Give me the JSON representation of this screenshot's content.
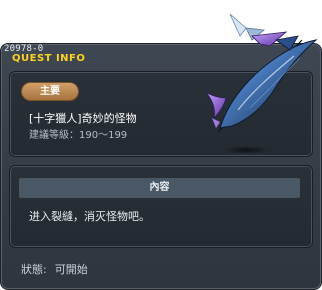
{
  "window": {
    "quest_id": "20978-0",
    "title": "QUEST INFO"
  },
  "main_panel": {
    "badge": "主要",
    "quest_name": "[十字獵人]奇妙的怪物",
    "level_label": "建議等級：",
    "level_range": "190～199"
  },
  "content_panel": {
    "header": "內容",
    "text": "进入裂縫，消灭怪物吧。"
  },
  "status": {
    "label": "狀態:",
    "value": "可開始"
  },
  "decoration": {
    "icon": "scythe-icon",
    "colors": {
      "accent": "#ffd21f",
      "badge": "#c08a52",
      "window": "#3a424b",
      "panel": "#272d34",
      "header_bar": "#4a5866"
    }
  }
}
